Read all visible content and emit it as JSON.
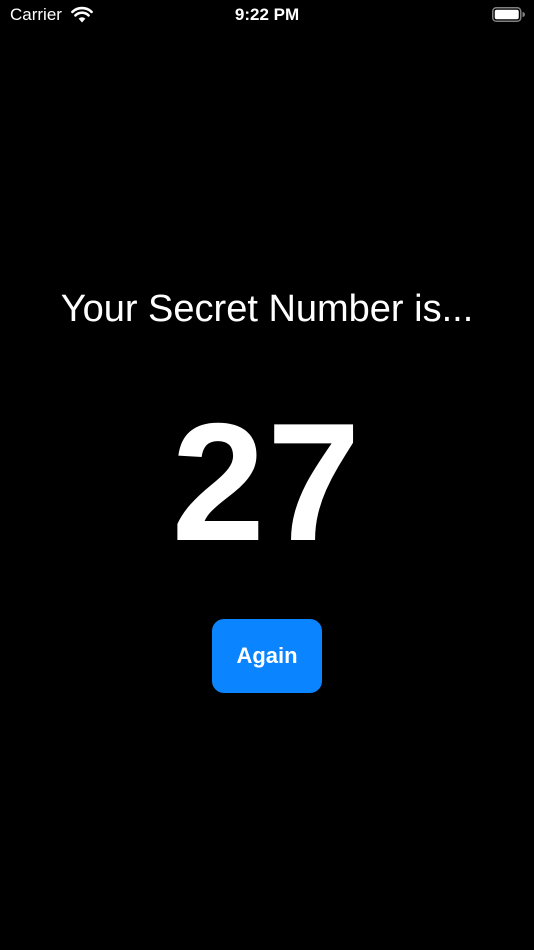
{
  "status_bar": {
    "carrier": "Carrier",
    "time": "9:22 PM",
    "wifi_icon": "wifi-icon",
    "battery_icon": "battery-full-icon",
    "battery_level": 1.0
  },
  "main": {
    "headline": "Your Secret Number is...",
    "secret_number": "27",
    "again_label": "Again"
  },
  "colors": {
    "background": "#000000",
    "text": "#ffffff",
    "accent": "#0a84ff"
  }
}
